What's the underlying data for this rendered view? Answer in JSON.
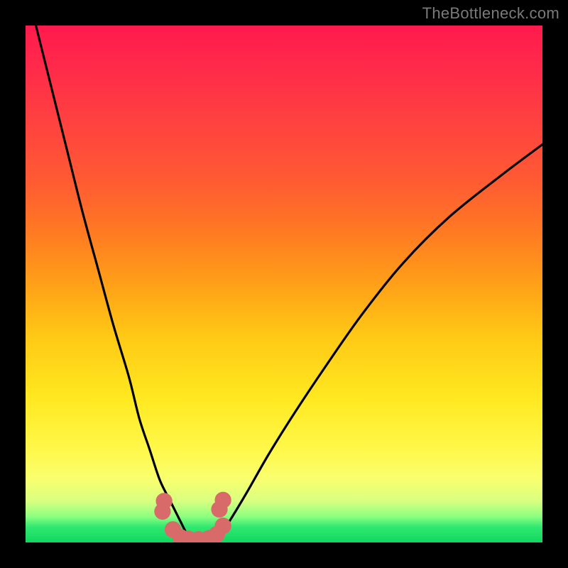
{
  "watermark": {
    "text": "TheBottleneck.com"
  },
  "colors": {
    "frame": "#000000",
    "curve": "#000000",
    "dot": "#d86a6a",
    "gradient_stops": [
      "#ff1a4d",
      "#ff4040",
      "#ff7a22",
      "#ffc815",
      "#fff84a",
      "#8cff80",
      "#10d860"
    ]
  },
  "chart_data": {
    "type": "line",
    "title": "",
    "xlabel": "",
    "ylabel": "",
    "xlim": [
      0,
      100
    ],
    "ylim": [
      0,
      100
    ],
    "legend": false,
    "grid": false,
    "series": [
      {
        "name": "left-curve",
        "x": [
          2,
          5,
          8,
          11,
          14,
          17,
          20,
          22,
          24,
          26,
          28,
          30,
          31,
          32
        ],
        "y": [
          100,
          88,
          76,
          64,
          53,
          42,
          32,
          24,
          18,
          12,
          8,
          4,
          2,
          0
        ]
      },
      {
        "name": "right-curve",
        "x": [
          36,
          38,
          40,
          43,
          47,
          52,
          58,
          65,
          73,
          82,
          92,
          100
        ],
        "y": [
          0,
          2,
          5,
          10,
          17,
          25,
          34,
          44,
          54,
          63,
          71,
          77
        ]
      }
    ],
    "dots": {
      "name": "bottom-dots",
      "points": [
        {
          "x": 26.5,
          "y": 6.0
        },
        {
          "x": 26.8,
          "y": 8.0
        },
        {
          "x": 28.5,
          "y": 2.5
        },
        {
          "x": 30.0,
          "y": 1.0
        },
        {
          "x": 31.5,
          "y": 0.7
        },
        {
          "x": 33.5,
          "y": 0.6
        },
        {
          "x": 35.5,
          "y": 0.8
        },
        {
          "x": 37.0,
          "y": 1.6
        },
        {
          "x": 38.2,
          "y": 3.2
        },
        {
          "x": 37.5,
          "y": 6.4
        },
        {
          "x": 38.2,
          "y": 8.2
        }
      ],
      "radius_pct": 1.6
    }
  }
}
